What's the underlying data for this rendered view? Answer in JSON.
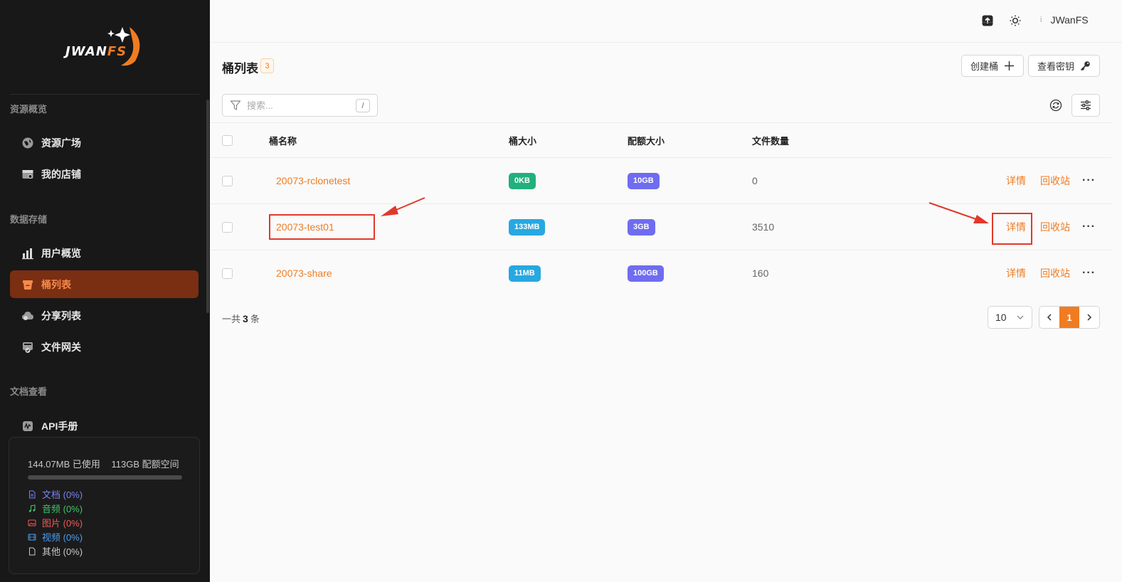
{
  "brand": {
    "logo_main": "JWAN",
    "logo_accent": "FS"
  },
  "sidebar": {
    "sections": [
      {
        "title": "资源概览",
        "items": [
          {
            "label": "资源广场",
            "icon": "globe-icon"
          },
          {
            "label": "我的店铺",
            "icon": "store-icon"
          }
        ]
      },
      {
        "title": "数据存储",
        "items": [
          {
            "label": "用户概览",
            "icon": "bar-chart-icon"
          },
          {
            "label": "桶列表",
            "icon": "bucket-icon",
            "active": true
          },
          {
            "label": "分享列表",
            "icon": "cloud-share-icon"
          },
          {
            "label": "文件网关",
            "icon": "gateway-icon"
          }
        ]
      },
      {
        "title": "文档查看",
        "items": [
          {
            "label": "API手册",
            "icon": "api-doc-icon"
          }
        ]
      }
    ],
    "storage": {
      "used": "144.07MB 已使用",
      "quota": "113GB 配额空间",
      "used_fraction": 0,
      "legend": [
        {
          "label": "文档 (0%)",
          "color": "#7b82f5",
          "icon": "document-icon"
        },
        {
          "label": "音频 (0%)",
          "color": "#3fc46a",
          "icon": "music-icon"
        },
        {
          "label": "图片 (0%)",
          "color": "#ef5a5a",
          "icon": "image-icon"
        },
        {
          "label": "视频 (0%)",
          "color": "#4a9ef0",
          "icon": "video-icon"
        },
        {
          "label": "其他 (0%)",
          "color": "#c8c8c8",
          "icon": "file-icon"
        }
      ]
    }
  },
  "header": {
    "user_initial": "i",
    "username": "JWanFS"
  },
  "page": {
    "title": "桶列表",
    "count": "3",
    "create_button": "创建桶",
    "keys_button": "查看密钥",
    "search_placeholder": "搜索...",
    "search_shortcut": "/"
  },
  "table": {
    "columns": {
      "name": "桶名称",
      "size": "桶大小",
      "quota": "配额大小",
      "files": "文件数量"
    },
    "rows": [
      {
        "name": "20073-rclonetest",
        "size": "0KB",
        "size_color": "#22b07d",
        "quota": "10GB",
        "quota_color": "#6f6cf0",
        "files": "0",
        "detail": "详情",
        "recycle": "回收站"
      },
      {
        "name": "20073-test01",
        "size": "133MB",
        "size_color": "#27a8e0",
        "quota": "3GB",
        "quota_color": "#6f6cf0",
        "files": "3510",
        "detail": "详情",
        "recycle": "回收站"
      },
      {
        "name": "20073-share",
        "size": "11MB",
        "size_color": "#27a8e0",
        "quota": "100GB",
        "quota_color": "#6f6cf0",
        "files": "160",
        "detail": "详情",
        "recycle": "回收站"
      }
    ],
    "more": "···"
  },
  "footer": {
    "total_prefix": "一共",
    "total_count": "3",
    "total_suffix": "条",
    "page_size": "10",
    "current_page": "1"
  },
  "colors": {
    "accent": "#f07c22",
    "sidebar_bg": "#181818",
    "active_bg": "#7a2e12",
    "annotation": "#e0392b"
  }
}
